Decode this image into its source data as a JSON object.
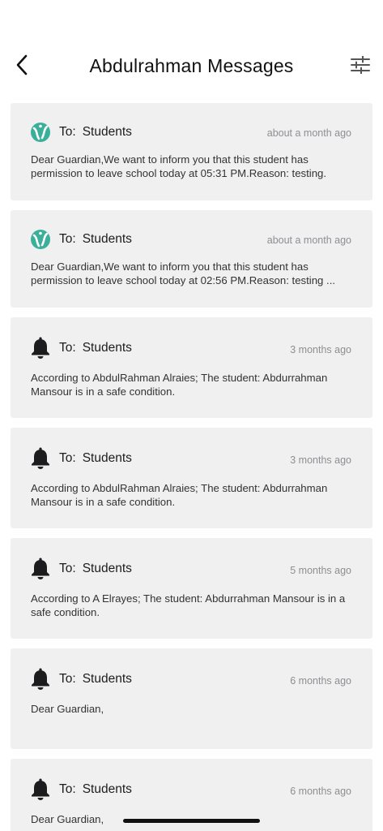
{
  "header": {
    "title": "Abdulrahman Messages",
    "back_icon": "chevron-left-icon",
    "filter_icon": "sliders-icon"
  },
  "colors": {
    "card_bg": "#f0f0f0",
    "time_text": "#8e8e93",
    "logo_teal": "#3aaf9a",
    "bell": "#1c1c1e"
  },
  "messages": [
    {
      "icon": "school-logo-icon",
      "to_label": "To:",
      "recipient": "Students",
      "time": "about a month ago",
      "body": "Dear Guardian,We want to inform you that this student has permission to leave school today at 05:31 PM.Reason: testing."
    },
    {
      "icon": "school-logo-icon",
      "to_label": "To:",
      "recipient": "Students",
      "time": "about a month ago",
      "body": "Dear Guardian,We want to inform you that this student has permission to leave school today at 02:56 PM.Reason: testing ..."
    },
    {
      "icon": "bell-icon",
      "to_label": "To:",
      "recipient": "Students",
      "time": "3 months ago",
      "body": "According to AbdulRahman Alraies; The student: Abdurrahman Mansour is in a safe condition."
    },
    {
      "icon": "bell-icon",
      "to_label": "To:",
      "recipient": "Students",
      "time": "3 months ago",
      "body": "According to AbdulRahman Alraies; The student: Abdurrahman Mansour is in a safe condition."
    },
    {
      "icon": "bell-icon",
      "to_label": "To:",
      "recipient": "Students",
      "time": "5 months ago",
      "body": "According to A Elrayes; The student: Abdurrahman Mansour is in a safe condition."
    },
    {
      "icon": "bell-icon",
      "to_label": "To:",
      "recipient": "Students",
      "time": "6 months ago",
      "body": "Dear Guardian,"
    },
    {
      "icon": "bell-icon",
      "to_label": "To:",
      "recipient": "Students",
      "time": "6 months ago",
      "body": "Dear Guardian,"
    }
  ]
}
